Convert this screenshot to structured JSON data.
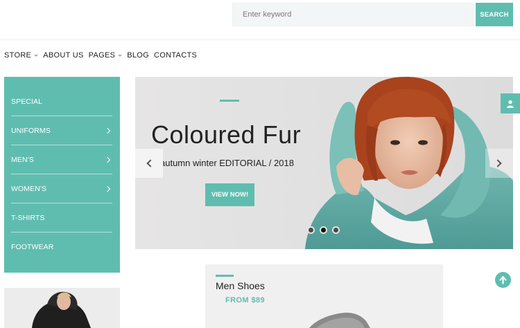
{
  "search": {
    "placeholder": "Enter keyword",
    "button_label": "SEARCH"
  },
  "nav": {
    "items": [
      {
        "label": "STORE",
        "has_dropdown": true
      },
      {
        "label": "ABOUT US",
        "has_dropdown": false
      },
      {
        "label": "PAGES",
        "has_dropdown": true
      },
      {
        "label": "BLOG",
        "has_dropdown": false
      },
      {
        "label": "CONTACTS",
        "has_dropdown": false
      }
    ]
  },
  "sidebar": {
    "items": [
      {
        "label": "SPECIAL",
        "has_submenu": false
      },
      {
        "label": "UNIFORMS",
        "has_submenu": true
      },
      {
        "label": "MEN'S",
        "has_submenu": true
      },
      {
        "label": "WOMEN'S",
        "has_submenu": true
      },
      {
        "label": "T-SHIRTS",
        "has_submenu": false
      },
      {
        "label": "FOOTWEAR",
        "has_submenu": false
      }
    ]
  },
  "slider": {
    "title": "Coloured Fur",
    "subtitle": "autumn winter EDITORIAL / 2018",
    "cta_label": "VIEW NOW!",
    "slide_count": 3,
    "active_slide": 2
  },
  "banner": {
    "title": "Men Shoes",
    "price": "FROM $89"
  },
  "colors": {
    "accent": "#5fbdb0",
    "text": "#222222",
    "slider_bg": "#e4e3e3"
  },
  "icons": {
    "user_tab": "user-icon",
    "back_to_top": "arrow-up-icon",
    "slider_prev": "chevron-left-icon",
    "slider_next": "chevron-right-icon"
  }
}
